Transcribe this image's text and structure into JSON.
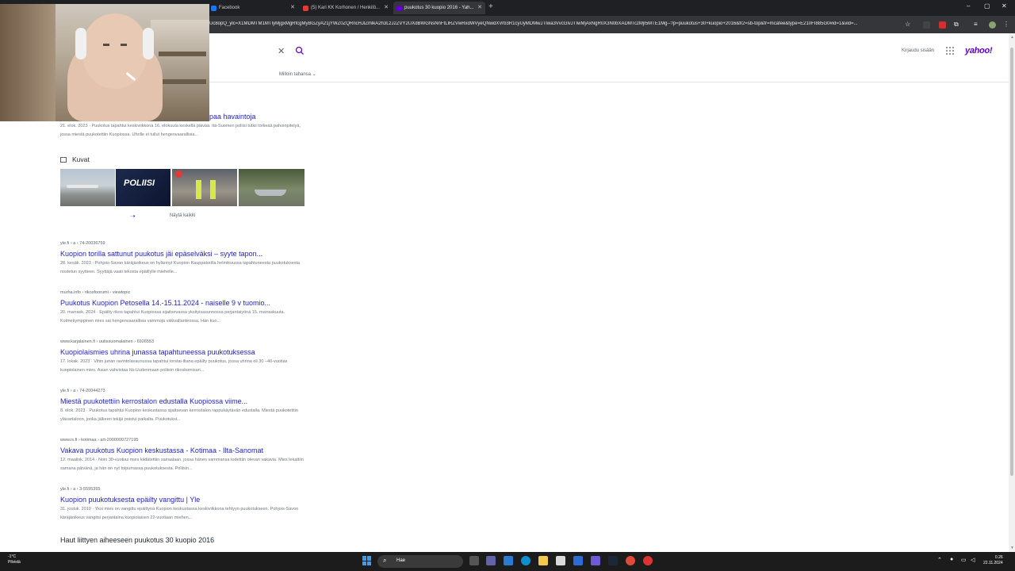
{
  "browser": {
    "tabs": [
      {
        "title": "Facebook",
        "active": false,
        "favicon_color": "#1877f2"
      },
      {
        "title": "(5) Kari KK Korhonen / Henkilö...",
        "active": false,
        "favicon_color": "#e53935"
      },
      {
        "title": "puukotus 30 kuopio 2016 - Yah...",
        "active": true,
        "favicon_color": "#6001d2"
      }
    ],
    "new_tab_label": "+",
    "window_controls": {
      "minimize": "–",
      "restore": "▢",
      "close": "✕"
    },
    "url": "Uc8opQ_ylc=X1MDMTM1MTIyMjgxMgRfcgMyBGZyA21jYWZ0ZQRncHJlZmlkA2h3LzJ2ZVY2UXdBWGNsNnFtLlRZVwRxdWVyeQNwdXVrb3R1cyUyMDMwJTIwa3VvcGlvJTIwMjAxNgR0X3N0bXADMTczMjI5MTE1Mg--?p=puukotus+30+kuopio+2016&fr2=sb-top&fr=mcafee&type=E210FI885G0#id=1&vid=..."
  },
  "yahoo": {
    "search": {
      "clear_icon": "✕"
    },
    "filter_label": "Milloin tahansa ⌄",
    "signin_label": "Kirjaudu sisään",
    "logo": "yahoo!"
  },
  "results_top": {
    "title_fragment": "paa havaintoja",
    "snippet": "21. elok. 2023 · Puukotus tapahtui keskiviikkona 16. elokuuta keskellä päivää. Itä-Suomen poliisi tutkii törkeää pahoinpitelyä, jossa miestä puukotettiin Kuopiossa. Uhrille ei tullut hengenvaarallisia..."
  },
  "images": {
    "heading": "Kuvat",
    "show_all": "Näytä kaikki",
    "show_all_arrow": "➝"
  },
  "results": [
    {
      "site": "yle.fi › a › 74-20036759",
      "title": "Kuopion torilla sattunut puukotus jäi epäselväksi – syyte tapon...",
      "snippet": "28. kesäk. 2023 · Pohjois-Savon käräjäoikeus on hylännyt Kuopion Kauppatorilla helmikuussa tapahtuneesta puukotuksesta nostetun syytteen. Syyttäjä vaati tekosta epäillylle miehelle..."
    },
    {
      "site": "murha.info › rikosfoorumi › viewtopic",
      "title": "Puukotus Kuopion Petosella 14.-15.11.2024 - naiselle 9 v tuomio...",
      "snippet": "20. marrask. 2024 · Epäilty rikos tapahtui Kuopiossa sijaitsevassa yksityisasunnossa perjantaiyönä 15. marraskuuta. Kolmekymppinen mies sai hengenvaarallisia vammoja väkivallanteossa. Hän kuo..."
    },
    {
      "site": "www.karjalainen.fi › uutissuomalainen › 6926553",
      "title": "Kuopiolaismies uhrina junassa tapahtuneessa puukotuksessa",
      "snippet": "17. lokak. 2023 · Vihin junan ravintolavaunussa tapahtui torstai-iltana epäilty puukotus, jossa uhrina oli 30 –40-vuotias kuopiolainen mies. Asian vahvistaa Itä-Uudenmaan poliisin rikoskomisari..."
    },
    {
      "site": "yle.fi › a › 74-20044273",
      "title": "Miestä puukotettiin kerrostalon edustalla Kuopiossa viime...",
      "snippet": "8. elok. 2023 · Puukotus tapahtui Kuopion keskustassa sijaitsevan kerrostalon rappukäytävän edustalla. Miestä puukotettiin ylävartaloon, jonka jälkeen tekijä poistui paikalta. Puukotuksi..."
    },
    {
      "site": "www.is.fi › kotimaa › art-2000000727195",
      "title": "Vakava puukotus Kuopion keskustassa - Kotimaa - Ilta-Sanomat",
      "snippet": "12. maalisk. 2014 · Noin 30-vuotias mies kiidätettiin sairaalaan, jossa hänen vammansa todettiin olevan vakavia. Mies lekattiin samana päivänä, ja hän on nyt toipumassa puukotuksesta. Poliisin..."
    },
    {
      "site": "yle.fi › a › 3-5595355",
      "title": "Kuopion puukotuksesta epäilty vangittu | Yle",
      "snippet": "31. jouluk. 2010 · Yksi mies on vangittu epäiltynä Kuopion keskustassa keskiviikkona tehtyyn puukotukseen. Pohjois-Savon käräjäoikeus vangitsi perjantaina kuopiolaisen 22-vuotiaan miehen..."
    }
  ],
  "related_heading": "Haut liittyen aiheeseen puukotus 30 kuopio 2016",
  "taskbar": {
    "weather_temp": "-1°C",
    "weather_desc": "Pilvistä",
    "search_placeholder": "Hae",
    "time": "0.26",
    "date": "22.11.2024"
  }
}
